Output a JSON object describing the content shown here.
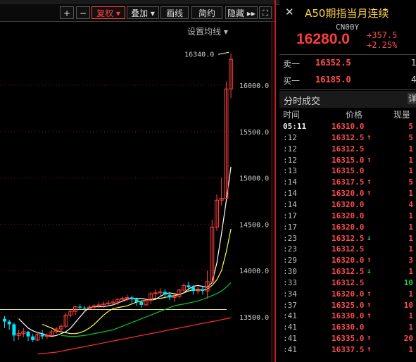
{
  "toolbar": {
    "plus_label": "+",
    "minus_label": "−",
    "fuquan_label": "复权 ▾",
    "diejia_label": "叠加 ▾",
    "huaxian_label": "画线",
    "jianyue_label": "简约",
    "yincang_label": "隐藏 ▸▸",
    "settings_label": "设置均线 ▾"
  },
  "chart_data": {
    "type": "candlestick",
    "price_labels": [
      "16000.0",
      "15500.0",
      "15000.0",
      "14500.0",
      "14000.0",
      "13500.0"
    ],
    "annotation": "16340.0",
    "colors": {
      "up": "#ff4040",
      "down": "#00e5ff",
      "ma5": "#ffffff",
      "ma10": "#ffff40",
      "ma20": "#00cc33",
      "ma60": "#ff3030"
    },
    "candles": [
      {
        "o": 13480,
        "h": 13510,
        "c": 13450,
        "l": 13380
      },
      {
        "o": 13450,
        "h": 13470,
        "c": 13420,
        "l": 13360
      },
      {
        "o": 13420,
        "h": 13440,
        "c": 13300,
        "l": 13240
      },
      {
        "o": 13300,
        "h": 13360,
        "c": 13320,
        "l": 13250
      },
      {
        "o": 13320,
        "h": 13380,
        "c": 13340,
        "l": 13280
      },
      {
        "o": 13340,
        "h": 13350,
        "c": 13290,
        "l": 13240
      },
      {
        "o": 13290,
        "h": 13320,
        "c": 13250,
        "l": 13230
      },
      {
        "o": 13250,
        "h": 13330,
        "c": 13310,
        "l": 13240
      },
      {
        "o": 13310,
        "h": 13360,
        "c": 13290,
        "l": 13260
      },
      {
        "o": 13290,
        "h": 13320,
        "c": 13300,
        "l": 13260
      },
      {
        "o": 13300,
        "h": 13360,
        "c": 13340,
        "l": 13280
      },
      {
        "o": 13340,
        "h": 13390,
        "c": 13370,
        "l": 13320
      },
      {
        "o": 13370,
        "h": 13420,
        "c": 13400,
        "l": 13340
      },
      {
        "o": 13400,
        "h": 13540,
        "c": 13520,
        "l": 13380
      },
      {
        "o": 13520,
        "h": 13580,
        "c": 13560,
        "l": 13500
      },
      {
        "o": 13560,
        "h": 13620,
        "c": 13610,
        "l": 13520
      },
      {
        "o": 13610,
        "h": 13640,
        "c": 13600,
        "l": 13580
      },
      {
        "o": 13600,
        "h": 13620,
        "c": 13590,
        "l": 13570
      },
      {
        "o": 13590,
        "h": 13630,
        "c": 13605,
        "l": 13580
      },
      {
        "o": 13605,
        "h": 13640,
        "c": 13620,
        "l": 13590
      },
      {
        "o": 13620,
        "h": 13660,
        "c": 13630,
        "l": 13600
      },
      {
        "o": 13630,
        "h": 13670,
        "c": 13640,
        "l": 13600
      },
      {
        "o": 13640,
        "h": 13680,
        "c": 13650,
        "l": 13610
      },
      {
        "o": 13650,
        "h": 13690,
        "c": 13660,
        "l": 13620
      },
      {
        "o": 13660,
        "h": 13700,
        "c": 13690,
        "l": 13630
      },
      {
        "o": 13690,
        "h": 13720,
        "c": 13700,
        "l": 13660
      },
      {
        "o": 13700,
        "h": 13740,
        "c": 13710,
        "l": 13670
      },
      {
        "o": 13710,
        "h": 13730,
        "c": 13690,
        "l": 13650
      },
      {
        "o": 13690,
        "h": 13710,
        "c": 13660,
        "l": 13620
      },
      {
        "o": 13660,
        "h": 13680,
        "c": 13630,
        "l": 13600
      },
      {
        "o": 13630,
        "h": 13700,
        "c": 13680,
        "l": 13620
      },
      {
        "o": 13680,
        "h": 13770,
        "c": 13750,
        "l": 13640
      },
      {
        "o": 13750,
        "h": 13800,
        "c": 13760,
        "l": 13700
      },
      {
        "o": 13760,
        "h": 13810,
        "c": 13770,
        "l": 13720
      },
      {
        "o": 13770,
        "h": 13800,
        "c": 13740,
        "l": 13700
      },
      {
        "o": 13740,
        "h": 13760,
        "c": 13710,
        "l": 13680
      },
      {
        "o": 13710,
        "h": 13740,
        "c": 13720,
        "l": 13660
      },
      {
        "o": 13720,
        "h": 13800,
        "c": 13790,
        "l": 13700
      },
      {
        "o": 13790,
        "h": 13860,
        "c": 13840,
        "l": 13760
      },
      {
        "o": 13840,
        "h": 13880,
        "c": 13820,
        "l": 13780
      },
      {
        "o": 13820,
        "h": 13840,
        "c": 13780,
        "l": 13740
      },
      {
        "o": 13780,
        "h": 13830,
        "c": 13800,
        "l": 13750
      },
      {
        "o": 13800,
        "h": 13830,
        "c": 13780,
        "l": 13740
      },
      {
        "o": 13780,
        "h": 14000,
        "c": 13880,
        "l": 13700
      },
      {
        "o": 13880,
        "h": 14550,
        "c": 14470,
        "l": 13870
      },
      {
        "o": 14470,
        "h": 14820,
        "c": 14760,
        "l": 14430
      },
      {
        "o": 14760,
        "h": 15000,
        "c": 14780,
        "l": 14700
      },
      {
        "o": 14780,
        "h": 16040,
        "c": 15960,
        "l": 14770
      },
      {
        "o": 15960,
        "h": 16340,
        "c": 16280,
        "l": 15860
      }
    ],
    "ma_lines": {
      "ma5": [
        13480,
        13430,
        13380,
        13350,
        13330,
        13320,
        13300,
        13290,
        13300,
        13320,
        13340,
        13380,
        13440,
        13500,
        13560,
        13600,
        13610,
        13610,
        13610,
        13620,
        13630,
        13650,
        13670,
        13690,
        13700,
        13700,
        13700,
        13690,
        13680,
        13690,
        13720,
        13750,
        13760,
        13750,
        13740,
        13760,
        13800,
        13830,
        13840,
        13830,
        13820,
        13870,
        14080,
        14400,
        14750,
        15120
      ],
      "ma10": [
        13420,
        13400,
        13380,
        13350,
        13340,
        13330,
        13320,
        13320,
        13330,
        13350,
        13380,
        13420,
        13470,
        13520,
        13560,
        13590,
        13600,
        13610,
        13620,
        13640,
        13660,
        13670,
        13680,
        13690,
        13700,
        13700,
        13710,
        13720,
        13730,
        13740,
        13760,
        13780,
        13790,
        13790,
        13790,
        13800,
        13840,
        13900,
        14000,
        14200,
        14450
      ],
      "ma20": [
        13300,
        13295,
        13290,
        13290,
        13295,
        13300,
        13310,
        13320,
        13330,
        13340,
        13350,
        13360,
        13380,
        13400,
        13420,
        13440,
        13460,
        13480,
        13500,
        13520,
        13540,
        13560,
        13580,
        13600,
        13620,
        13630,
        13640,
        13650,
        13660,
        13670,
        13690,
        13710,
        13730,
        13750,
        13780,
        13820,
        13870
      ],
      "ma60": [
        13100,
        13105,
        13110,
        13115,
        13120,
        13130,
        13140,
        13150,
        13160,
        13170,
        13180,
        13190,
        13200,
        13210,
        13220,
        13230,
        13240,
        13250,
        13260,
        13270,
        13280,
        13290,
        13300,
        13310,
        13320,
        13330,
        13340,
        13350,
        13360,
        13370,
        13380,
        13390,
        13400,
        13410,
        13420,
        13430,
        13440,
        13450,
        13460,
        13470,
        13480,
        13490
      ]
    },
    "yellow_flat": 13580
  },
  "quote": {
    "title": "A50期指当月连续",
    "code": "CN00Y",
    "price": "16280.0",
    "change": "+357.5",
    "change_pct": "+2.25%",
    "ask_label": "卖一",
    "ask_price": "16352.5",
    "ask_qty": "1",
    "bid_label": "买一",
    "bid_price": "16185.0",
    "bid_qty": "4"
  },
  "trades": {
    "tab_label": "分时成交",
    "detail_label": "详",
    "col_time": "时间",
    "col_price": "价格",
    "col_volume": "现量",
    "rows": [
      {
        "time": "05:11",
        "price": "16310.0",
        "arrow": "",
        "vol": "5",
        "vcolor": "#ff4d4d"
      },
      {
        "time": ":12",
        "price": "16312.5",
        "arrow": "↑",
        "vol": "5",
        "vcolor": "#ff4d4d"
      },
      {
        "time": ":12",
        "price": "16312.5",
        "arrow": "",
        "vol": "1",
        "vcolor": "#ff4d4d"
      },
      {
        "time": ":12",
        "price": "16315.0",
        "arrow": "↑",
        "vol": "1",
        "vcolor": "#ff4d4d"
      },
      {
        "time": ":13",
        "price": "16315.0",
        "arrow": "",
        "vol": "1",
        "vcolor": "#ff4d4d"
      },
      {
        "time": ":14",
        "price": "16317.5",
        "arrow": "↑",
        "vol": "5",
        "vcolor": "#ff4d4d"
      },
      {
        "time": ":14",
        "price": "16320.0",
        "arrow": "↑",
        "vol": "1",
        "vcolor": "#ff4d4d"
      },
      {
        "time": ":14",
        "price": "16320.0",
        "arrow": "",
        "vol": "4",
        "vcolor": "#ff4d4d"
      },
      {
        "time": ":17",
        "price": "16320.0",
        "arrow": "",
        "vol": "1",
        "vcolor": "#ff4d4d"
      },
      {
        "time": ":17",
        "price": "16320.0",
        "arrow": "",
        "vol": "1",
        "vcolor": "#ff4d4d"
      },
      {
        "time": ":23",
        "price": "16312.5",
        "arrow": "↓",
        "vol": "1",
        "vcolor": "#ff4d4d"
      },
      {
        "time": ":23",
        "price": "16312.5",
        "arrow": "",
        "vol": "1",
        "vcolor": "#ff4d4d"
      },
      {
        "time": ":29",
        "price": "16320.0",
        "arrow": "↑",
        "vol": "3",
        "vcolor": "#ff4d4d"
      },
      {
        "time": ":30",
        "price": "16312.5",
        "arrow": "↓",
        "vol": "1",
        "vcolor": "#ff4d4d"
      },
      {
        "time": ":33",
        "price": "16312.5",
        "arrow": "",
        "vol": "10",
        "vcolor": "#2ecc40"
      },
      {
        "time": ":34",
        "price": "16320.0",
        "arrow": "↑",
        "vol": "1",
        "vcolor": "#ff4d4d"
      },
      {
        "time": ":37",
        "price": "16325.0",
        "arrow": "↑",
        "vol": "10",
        "vcolor": "#ff4d4d"
      },
      {
        "time": ":41",
        "price": "16330.0",
        "arrow": "↑",
        "vol": "1",
        "vcolor": "#ff4d4d"
      },
      {
        "time": ":41",
        "price": "16330.0",
        "arrow": "",
        "vol": "1",
        "vcolor": "#ff4d4d"
      },
      {
        "time": ":41",
        "price": "16335.0",
        "arrow": "↑",
        "vol": "20",
        "vcolor": "#ff4d4d"
      },
      {
        "time": ":41",
        "price": "16337.5",
        "arrow": "↑",
        "vol": "1",
        "vcolor": "#ff4d4d"
      }
    ]
  }
}
